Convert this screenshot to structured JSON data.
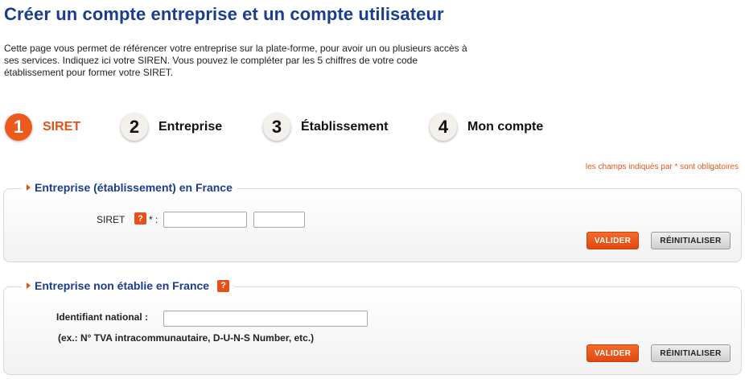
{
  "page": {
    "title": "Créer un compte entreprise et un compte utilisateur",
    "intro": "Cette page vous permet de référencer votre entreprise sur la plate-forme, pour avoir un ou plusieurs accès à ses services. Indiquez ici votre SIREN. Vous pouvez le compléter par les 5 chiffres de votre code établissement pour former votre SIRET."
  },
  "steps": [
    {
      "number": "1",
      "label": "SIRET",
      "active": true
    },
    {
      "number": "2",
      "label": "Entreprise",
      "active": false
    },
    {
      "number": "3",
      "label": "Établissement",
      "active": false
    },
    {
      "number": "4",
      "label": "Mon compte",
      "active": false
    }
  ],
  "required_note": "les champs indiqués par * sont obligatoires",
  "section_france": {
    "legend": "Entreprise (établissement) en France",
    "siret_label": "SIRET",
    "help_glyph": "?",
    "required_marker": "* :",
    "siren_value": "",
    "etab_value": "",
    "validate_label": "VALIDER",
    "reset_label": "RÉINITIALISER"
  },
  "section_foreign": {
    "legend": "Entreprise non établie en France",
    "help_glyph": "?",
    "id_label": "Identifiant national :",
    "id_value": "",
    "example": "(ex.: N° TVA intracommunautaire, D-U-N-S Number, etc.)",
    "validate_label": "VALIDER",
    "reset_label": "RÉINITIALISER"
  },
  "colors": {
    "title_blue": "#1a3e8c",
    "accent_orange": "#e8501a"
  }
}
